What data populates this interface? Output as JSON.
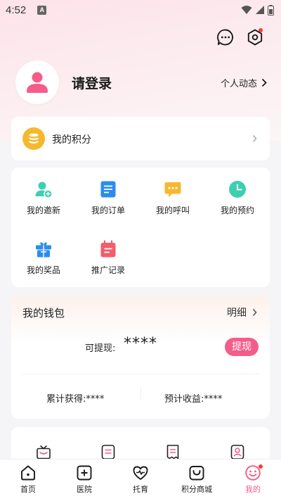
{
  "status_bar": {
    "time": "4:52",
    "notification_badge": "A"
  },
  "header": {
    "login_text": "请登录",
    "dynamics_label": "个人动态"
  },
  "points_card": {
    "label": "我的积分"
  },
  "grid": {
    "items": [
      {
        "label": "我的邀新",
        "icon": "invite-user-icon"
      },
      {
        "label": "我的订单",
        "icon": "order-doc-icon"
      },
      {
        "label": "我的呼叫",
        "icon": "call-chat-icon"
      },
      {
        "label": "我的预约",
        "icon": "appointment-clock-icon"
      },
      {
        "label": "我的奖品",
        "icon": "prize-gift-icon"
      },
      {
        "label": "推广记录",
        "icon": "promo-record-icon"
      }
    ]
  },
  "wallet": {
    "title": "我的钱包",
    "detail_label": "明细",
    "withdrawable_label": "可提现:",
    "withdrawable_value": "****",
    "withdraw_button": "提现",
    "accumulated_label": "累计获得:****",
    "estimated_label": "预计收益:****"
  },
  "tabs": [
    {
      "label": "首页",
      "icon": "home-icon"
    },
    {
      "label": "医院",
      "icon": "hospital-icon"
    },
    {
      "label": "托育",
      "icon": "childcare-heart-icon"
    },
    {
      "label": "积分商城",
      "icon": "shopping-bag-icon"
    },
    {
      "label": "我的",
      "icon": "smiley-icon",
      "active": true
    }
  ],
  "colors": {
    "accent": "#f45d8a",
    "badge_red": "#ff3b30",
    "points_gold": "#f5b82e",
    "header_gradient_start": "#fde3ea"
  }
}
